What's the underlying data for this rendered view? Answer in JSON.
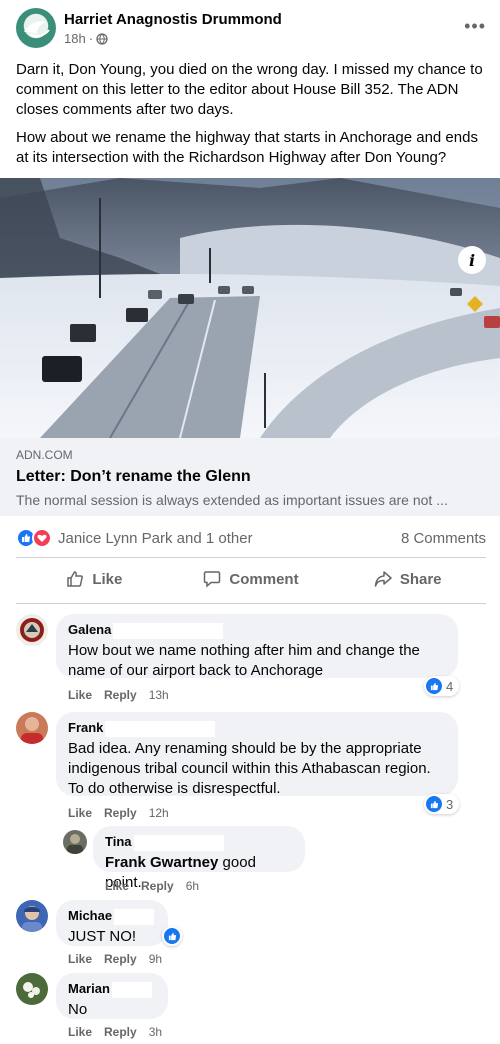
{
  "post": {
    "author": "Harriet Anagnostis Drummond",
    "time": "18h",
    "privacy_icon": "globe-icon",
    "more_icon": "more-dots-icon",
    "more_label": "•••",
    "text_p1": "Darn it, Don Young, you died on the wrong day. I missed my chance to comment on this letter to the editor about House Bill 352. The ADN closes comments after two days.",
    "text_p2": "How about we rename the highway that starts in Anchorage and ends at its intersection with the Richardson Highway after Don Young?"
  },
  "link": {
    "domain": "ADN.COM",
    "title": "Letter: Don’t rename the Glenn",
    "description": "The normal session is always extended as important issues are not ...",
    "info_label": "i"
  },
  "reactions": {
    "names": "Janice Lynn Park and 1 other",
    "comments_count": "8 Comments"
  },
  "actions": {
    "like": "Like",
    "comment": "Comment",
    "share": "Share"
  },
  "comments": [
    {
      "name": "Galena",
      "text": "How bout we name nothing after him and change the name of our airport back to Anchorage",
      "like": "Like",
      "reply": "Reply",
      "time": "13h",
      "reactions": "4"
    },
    {
      "name": "Frank",
      "text": "Bad idea. Any renaming should be by the appropriate indigenous tribal council within this Athabascan region. To do otherwise is disrespectful.",
      "like": "Like",
      "reply": "Reply",
      "time": "12h",
      "reactions": "3"
    },
    {
      "name": "Tina",
      "mention": "Frank Gwartney",
      "text": " good point.",
      "like": "Like",
      "reply": "Reply",
      "time": "6h"
    },
    {
      "name": "Michae",
      "text": "JUST NO!",
      "like": "Like",
      "reply": "Reply",
      "time": "9h"
    },
    {
      "name": "Marian",
      "text": "No",
      "like": "Like",
      "reply": "Reply",
      "time": "3h"
    }
  ],
  "colors": {
    "accent": "#1877f2",
    "love": "#f33e58",
    "secondary_text": "#65676b",
    "bubble": "#f0f2f5"
  }
}
